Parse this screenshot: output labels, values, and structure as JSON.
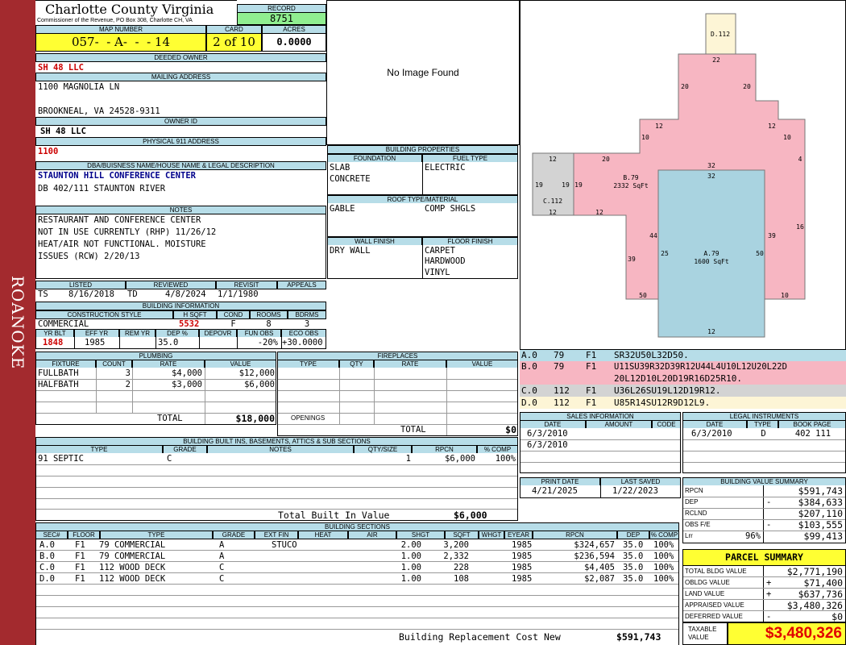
{
  "sidebar": {
    "label": "ROANOKE"
  },
  "header": {
    "county": "Charlotte County Virginia",
    "subtitle": "Commissioner of the Revenue, PO Box 308, Charlotte CH, VA",
    "record_label": "RECORD",
    "record": "8751"
  },
  "parcel": {
    "map_label": "MAP NUMBER",
    "map": "057-  - A-  -  - 14",
    "card_label": "CARD",
    "card": "2 of 10",
    "acres_label": "ACRES",
    "acres": "0.0000"
  },
  "owner": {
    "deeded_label": "DEEDED OWNER",
    "deeded": "SH 48 LLC",
    "mail_label": "MAILING ADDRESS",
    "mail1": "1100 MAGNOLIA LN",
    "mail2": "BROOKNEAL, VA 24528-9311",
    "ownerid_label": "OWNER ID",
    "ownerid": "SH 48 LLC",
    "phys_label": "PHYSICAL 911 ADDRESS",
    "phys": "1100"
  },
  "dba": {
    "label": "DBA/BUISNESS NAME/HOUSE NAME & LEGAL DESCRIPTION",
    "name": "STAUNTON HILL CONFERENCE CENTER",
    "legal": "DB 402/111 STAUNTON RIVER"
  },
  "notes": {
    "label": "NOTES",
    "lines": [
      "RESTAURANT AND CONFERENCE CENTER",
      "NOT IN USE CURRENTLY (RHP) 11/26/12",
      "HEAT/AIR NOT FUNCTIONAL. MOISTURE",
      "ISSUES (RCW) 2/20/13"
    ]
  },
  "listing": {
    "h": [
      "LISTED",
      "REVIEWED",
      "REVISIT",
      "APPEALS"
    ],
    "listed_by": "TS",
    "listed": "8/16/2018",
    "reviewed_by": "TD",
    "reviewed": "4/8/2024",
    "revisit": "1/1/1980",
    "appeals": ""
  },
  "bldg_info": {
    "label": "BUILDING INFORMATION",
    "h1": [
      "CONSTRUCTION STYLE",
      "H SQFT",
      "COND",
      "ROOMS",
      "BDRMS"
    ],
    "style": "COMMERCIAL",
    "hsqft": "5532",
    "cond": "F",
    "rooms": "8",
    "bdrms": "3",
    "h2": [
      "YR BLT",
      "EFF YR",
      "REM YR",
      "DEP %",
      "DEPOVR",
      "FUN OBS",
      "ECO OBS"
    ],
    "yrblt": "1848",
    "effyr": "1985",
    "remyr": "",
    "dep": "35.0",
    "depovr": "",
    "funobs": "-20%",
    "ecoobs": "+30.0000"
  },
  "image": {
    "none": "No Image Found"
  },
  "props": {
    "label": "BUILDING PROPERTIES",
    "found_label": "FOUNDATION",
    "fuel_label": "FUEL TYPE",
    "found1": "SLAB",
    "found2": "CONCRETE",
    "fuel": "ELECTRIC",
    "roof_label": "ROOF TYPE/MATERIAL",
    "roof1": "GABLE",
    "roof2": "COMP SHGLS",
    "wall_label": "WALL FINISH",
    "floor_label": "FLOOR FINISH",
    "wall": "DRY WALL",
    "floor1": "CARPET",
    "floor2": "HARDWOOD",
    "floor3": "VINYL"
  },
  "sketch": {
    "colors": {
      "pink": "#f7b6c2",
      "blue": "#a9d3e0",
      "gray": "#d3d3d3",
      "cream": "#fdf5d6"
    },
    "areas": [
      {
        "id": "D.112"
      },
      {
        "id": "B.79",
        "sqft": "2332 SqFt"
      },
      {
        "id": "A.79",
        "sqft": "1600 SqFt"
      },
      {
        "id": "C.112"
      }
    ],
    "dims": [
      "22",
      "20",
      "20",
      "12",
      "12",
      "10",
      "10",
      "12",
      "20",
      "4",
      "32",
      "32",
      "12",
      "19",
      "19",
      "19",
      "12",
      "16",
      "44",
      "39",
      "39",
      "25",
      "50",
      "50",
      "10",
      "12",
      "32"
    ]
  },
  "vectors": [
    {
      "code": "A.0",
      "num": "79",
      "fl": "F1",
      "path": "SR32U50L32D50.",
      "bg": "#b7dde8"
    },
    {
      "code": "B.0",
      "num": "79",
      "fl": "F1",
      "path": "U11SU39R32D39R12U44L4U10L12U20L22D",
      "bg": "#f7b6c2"
    },
    {
      "code": "",
      "num": "",
      "fl": "",
      "path": "20L12D10L20D19R16D25R10.",
      "bg": "#f7b6c2"
    },
    {
      "code": "C.0",
      "num": "112",
      "fl": "F1",
      "path": "U36L26SU19L12D19R12.",
      "bg": "#d3d3d3"
    },
    {
      "code": "D.0",
      "num": "112",
      "fl": "F1",
      "path": "U85R14SU12R9D12L9.",
      "bg": "#fdf5d6"
    }
  ],
  "sales": {
    "label": "SALES INFORMATION",
    "h": [
      "DATE",
      "AMOUNT",
      "CODE"
    ],
    "rows": [
      {
        "date": "6/3/2010",
        "amount": "",
        "code": ""
      },
      {
        "date": "6/3/2010",
        "amount": "",
        "code": ""
      }
    ]
  },
  "legal": {
    "label": "LEGAL INSTRUMENTS",
    "h": [
      "DATE",
      "TYPE",
      "BOOK PAGE"
    ],
    "rows": [
      {
        "date": "6/3/2010",
        "type": "D",
        "book": "402 111"
      }
    ]
  },
  "print": {
    "h": [
      "PRINT DATE",
      "LAST SAVED"
    ],
    "print": "4/21/2025",
    "saved": "1/22/2023"
  },
  "plumbing": {
    "label": "PLUMBING",
    "h": [
      "FIXTURE",
      "COUNT",
      "RATE",
      "VALUE"
    ],
    "rows": [
      {
        "fixture": "FULLBATH",
        "count": "3",
        "rate": "$4,000",
        "value": "$12,000"
      },
      {
        "fixture": "HALFBATH",
        "count": "2",
        "rate": "$3,000",
        "value": "$6,000"
      }
    ],
    "total_label": "TOTAL",
    "total": "$18,000"
  },
  "fireplaces": {
    "label": "FIREPLACES",
    "h": [
      "TYPE",
      "QTY",
      "RATE",
      "VALUE"
    ],
    "openings": "OPENINGS",
    "total_label": "TOTAL",
    "total": "$0"
  },
  "builtins": {
    "label": "BUILDING BUILT INS, BASEMENTS, ATTICS & SUB SECTIONS",
    "h": [
      "TYPE",
      "GRADE",
      "NOTES",
      "QTY/SIZE",
      "RPCN",
      "% COMP"
    ],
    "rows": [
      {
        "type": "91 SEPTIC",
        "grade": "C",
        "notes": "",
        "qty": "1",
        "rpcn": "$6,000",
        "comp": "100%"
      }
    ],
    "total_label": "Total Built In Value",
    "total": "$6,000"
  },
  "sections": {
    "label": "BUILDING SECTIONS",
    "h": [
      "SEC#",
      "FLOOR",
      "TYPE",
      "GRADE",
      "EXT FIN",
      "HEAT",
      "AIR",
      "SHGT",
      "SQFT",
      "WHGT",
      "EYEAR",
      "RPCN",
      "DEP",
      "% COMP"
    ],
    "rows": [
      {
        "sec": "A.0",
        "floor": "F1",
        "type": "79 COMMERCIAL",
        "grade": "A",
        "ext": "STUCO",
        "heat": "",
        "air": "",
        "shgt": "2.00",
        "sqft": "3,200",
        "whgt": "",
        "eyear": "1985",
        "rpcn": "$324,657",
        "dep": "35.0",
        "comp": "100%"
      },
      {
        "sec": "B.0",
        "floor": "F1",
        "type": "79 COMMERCIAL",
        "grade": "A",
        "ext": "",
        "heat": "",
        "air": "",
        "shgt": "1.00",
        "sqft": "2,332",
        "whgt": "",
        "eyear": "1985",
        "rpcn": "$236,594",
        "dep": "35.0",
        "comp": "100%"
      },
      {
        "sec": "C.0",
        "floor": "F1",
        "type": "112 WOOD DECK",
        "grade": "C",
        "ext": "",
        "heat": "",
        "air": "",
        "shgt": "1.00",
        "sqft": "228",
        "whgt": "",
        "eyear": "1985",
        "rpcn": "$4,405",
        "dep": "35.0",
        "comp": "100%"
      },
      {
        "sec": "D.0",
        "floor": "F1",
        "type": "112 WOOD DECK",
        "grade": "C",
        "ext": "",
        "heat": "",
        "air": "",
        "shgt": "1.00",
        "sqft": "108",
        "whgt": "",
        "eyear": "1985",
        "rpcn": "$2,087",
        "dep": "35.0",
        "comp": "100%"
      }
    ],
    "total_label": "Building Replacement Cost New",
    "total": "$591,743"
  },
  "bvs": {
    "label": "BUILDING VALUE SUMMARY",
    "rows": [
      {
        "k": "RPCN",
        "sign": "",
        "v": "$591,743"
      },
      {
        "k": "DEP",
        "sign": "-",
        "v": "$384,633"
      },
      {
        "k": "RCLND",
        "sign": "",
        "v": "$207,110"
      },
      {
        "k": "OBS F/E",
        "sign": "-",
        "v": "$103,555"
      },
      {
        "k": "Lrr",
        "pct": "96%",
        "sign": "",
        "v": "$99,413"
      }
    ]
  },
  "ps": {
    "label": "PARCEL SUMMARY",
    "rows": [
      {
        "k": "TOTAL BLDG VALUE",
        "sign": "",
        "v": "$2,771,190"
      },
      {
        "k": "OBLDG VALUE",
        "sign": "+",
        "v": "$71,400"
      },
      {
        "k": "LAND VALUE",
        "sign": "+",
        "v": "$637,736"
      },
      {
        "k": "APPRAISED VALUE",
        "sign": "",
        "v": "$3,480,326"
      },
      {
        "k": "DEFERRED VALUE",
        "sign": "-",
        "v": "$0"
      }
    ],
    "taxable_label1": "TAXABLE",
    "taxable_label2": "VALUE",
    "taxable": "$3,480,326"
  }
}
